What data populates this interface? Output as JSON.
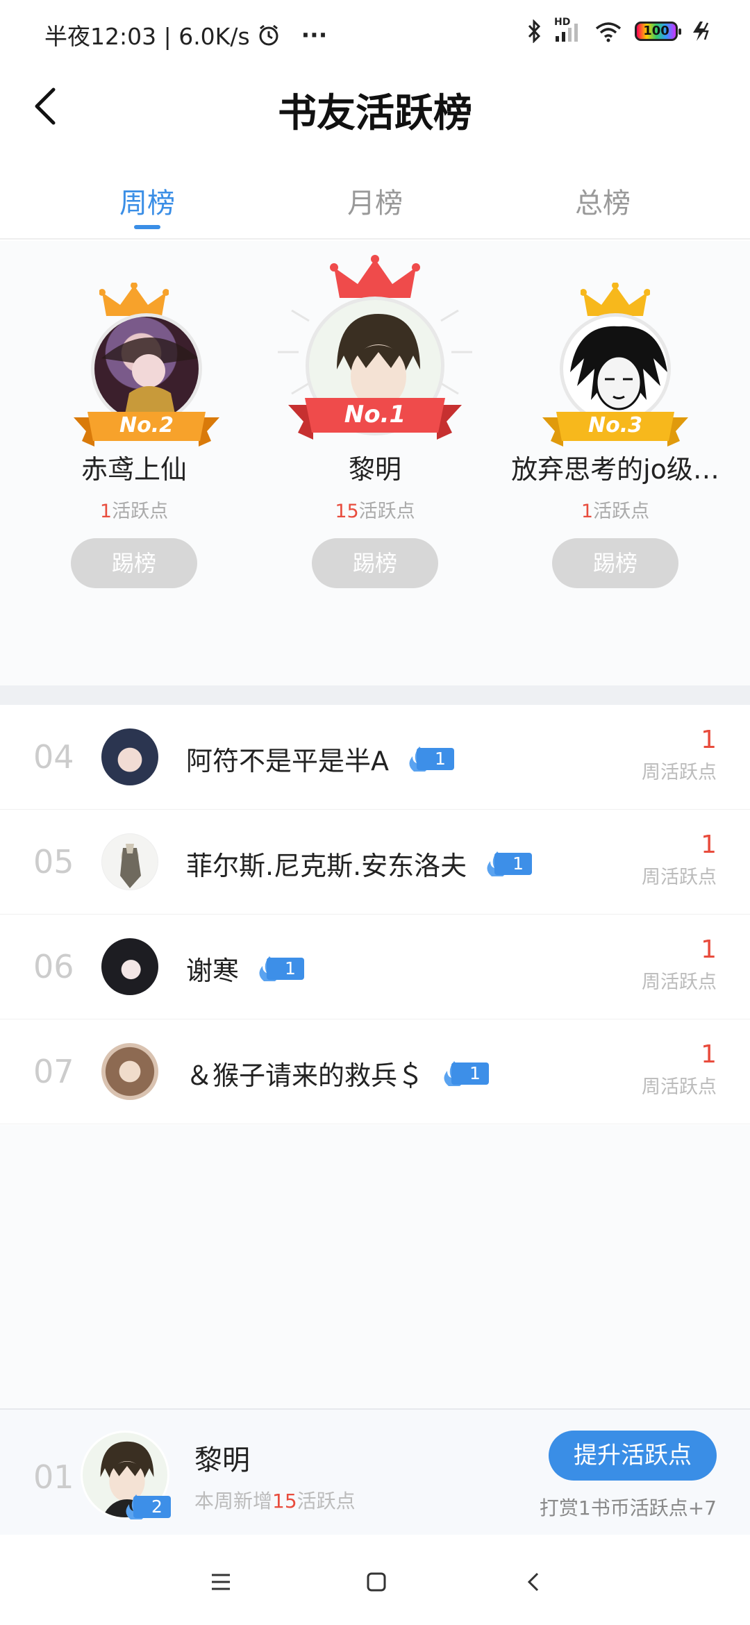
{
  "status_bar": {
    "time_speed": "半夜12:03 | 6.0K/s",
    "more": "···",
    "network": "HD",
    "battery": "100"
  },
  "header": {
    "title": "书友活跃榜"
  },
  "tabs": [
    {
      "label": "周榜",
      "active": true
    },
    {
      "label": "月榜",
      "active": false
    },
    {
      "label": "总榜",
      "active": false
    }
  ],
  "podium": {
    "first": {
      "rank_label": "No.1",
      "name": "黎明",
      "points": "15",
      "points_unit": "活跃点",
      "kick_label": "踢榜"
    },
    "second": {
      "rank_label": "No.2",
      "name": "赤鸢上仙",
      "points": "1",
      "points_unit": "活跃点",
      "kick_label": "踢榜"
    },
    "third": {
      "rank_label": "No.3",
      "name": "放弃思考的jo级…",
      "points": "1",
      "points_unit": "活跃点",
      "kick_label": "踢榜"
    }
  },
  "list": [
    {
      "rank": "04",
      "name": "阿符不是平是半A",
      "badge": "1",
      "points": "1",
      "unit": "周活跃点"
    },
    {
      "rank": "05",
      "name": "菲尔斯.尼克斯.安东洛夫",
      "badge": "1",
      "points": "1",
      "unit": "周活跃点"
    },
    {
      "rank": "06",
      "name": "谢寒",
      "badge": "1",
      "points": "1",
      "unit": "周活跃点"
    },
    {
      "rank": "07",
      "name": "＆猴子请来的救兵＄",
      "badge": "1",
      "points": "1",
      "unit": "周活跃点"
    }
  ],
  "me": {
    "rank": "01",
    "name": "黎明",
    "badge": "2",
    "sub_prefix": "本周新增",
    "sub_points": "15",
    "sub_suffix": "活跃点",
    "boost_label": "提升活跃点",
    "boost_hint": "打赏1书币活跃点+7"
  },
  "colors": {
    "accent": "#3a8ee6",
    "points": "#e84c3d",
    "crown_red": "#ef4b4b",
    "crown_orange": "#f7a22b",
    "crown_gold": "#f7b81c"
  }
}
